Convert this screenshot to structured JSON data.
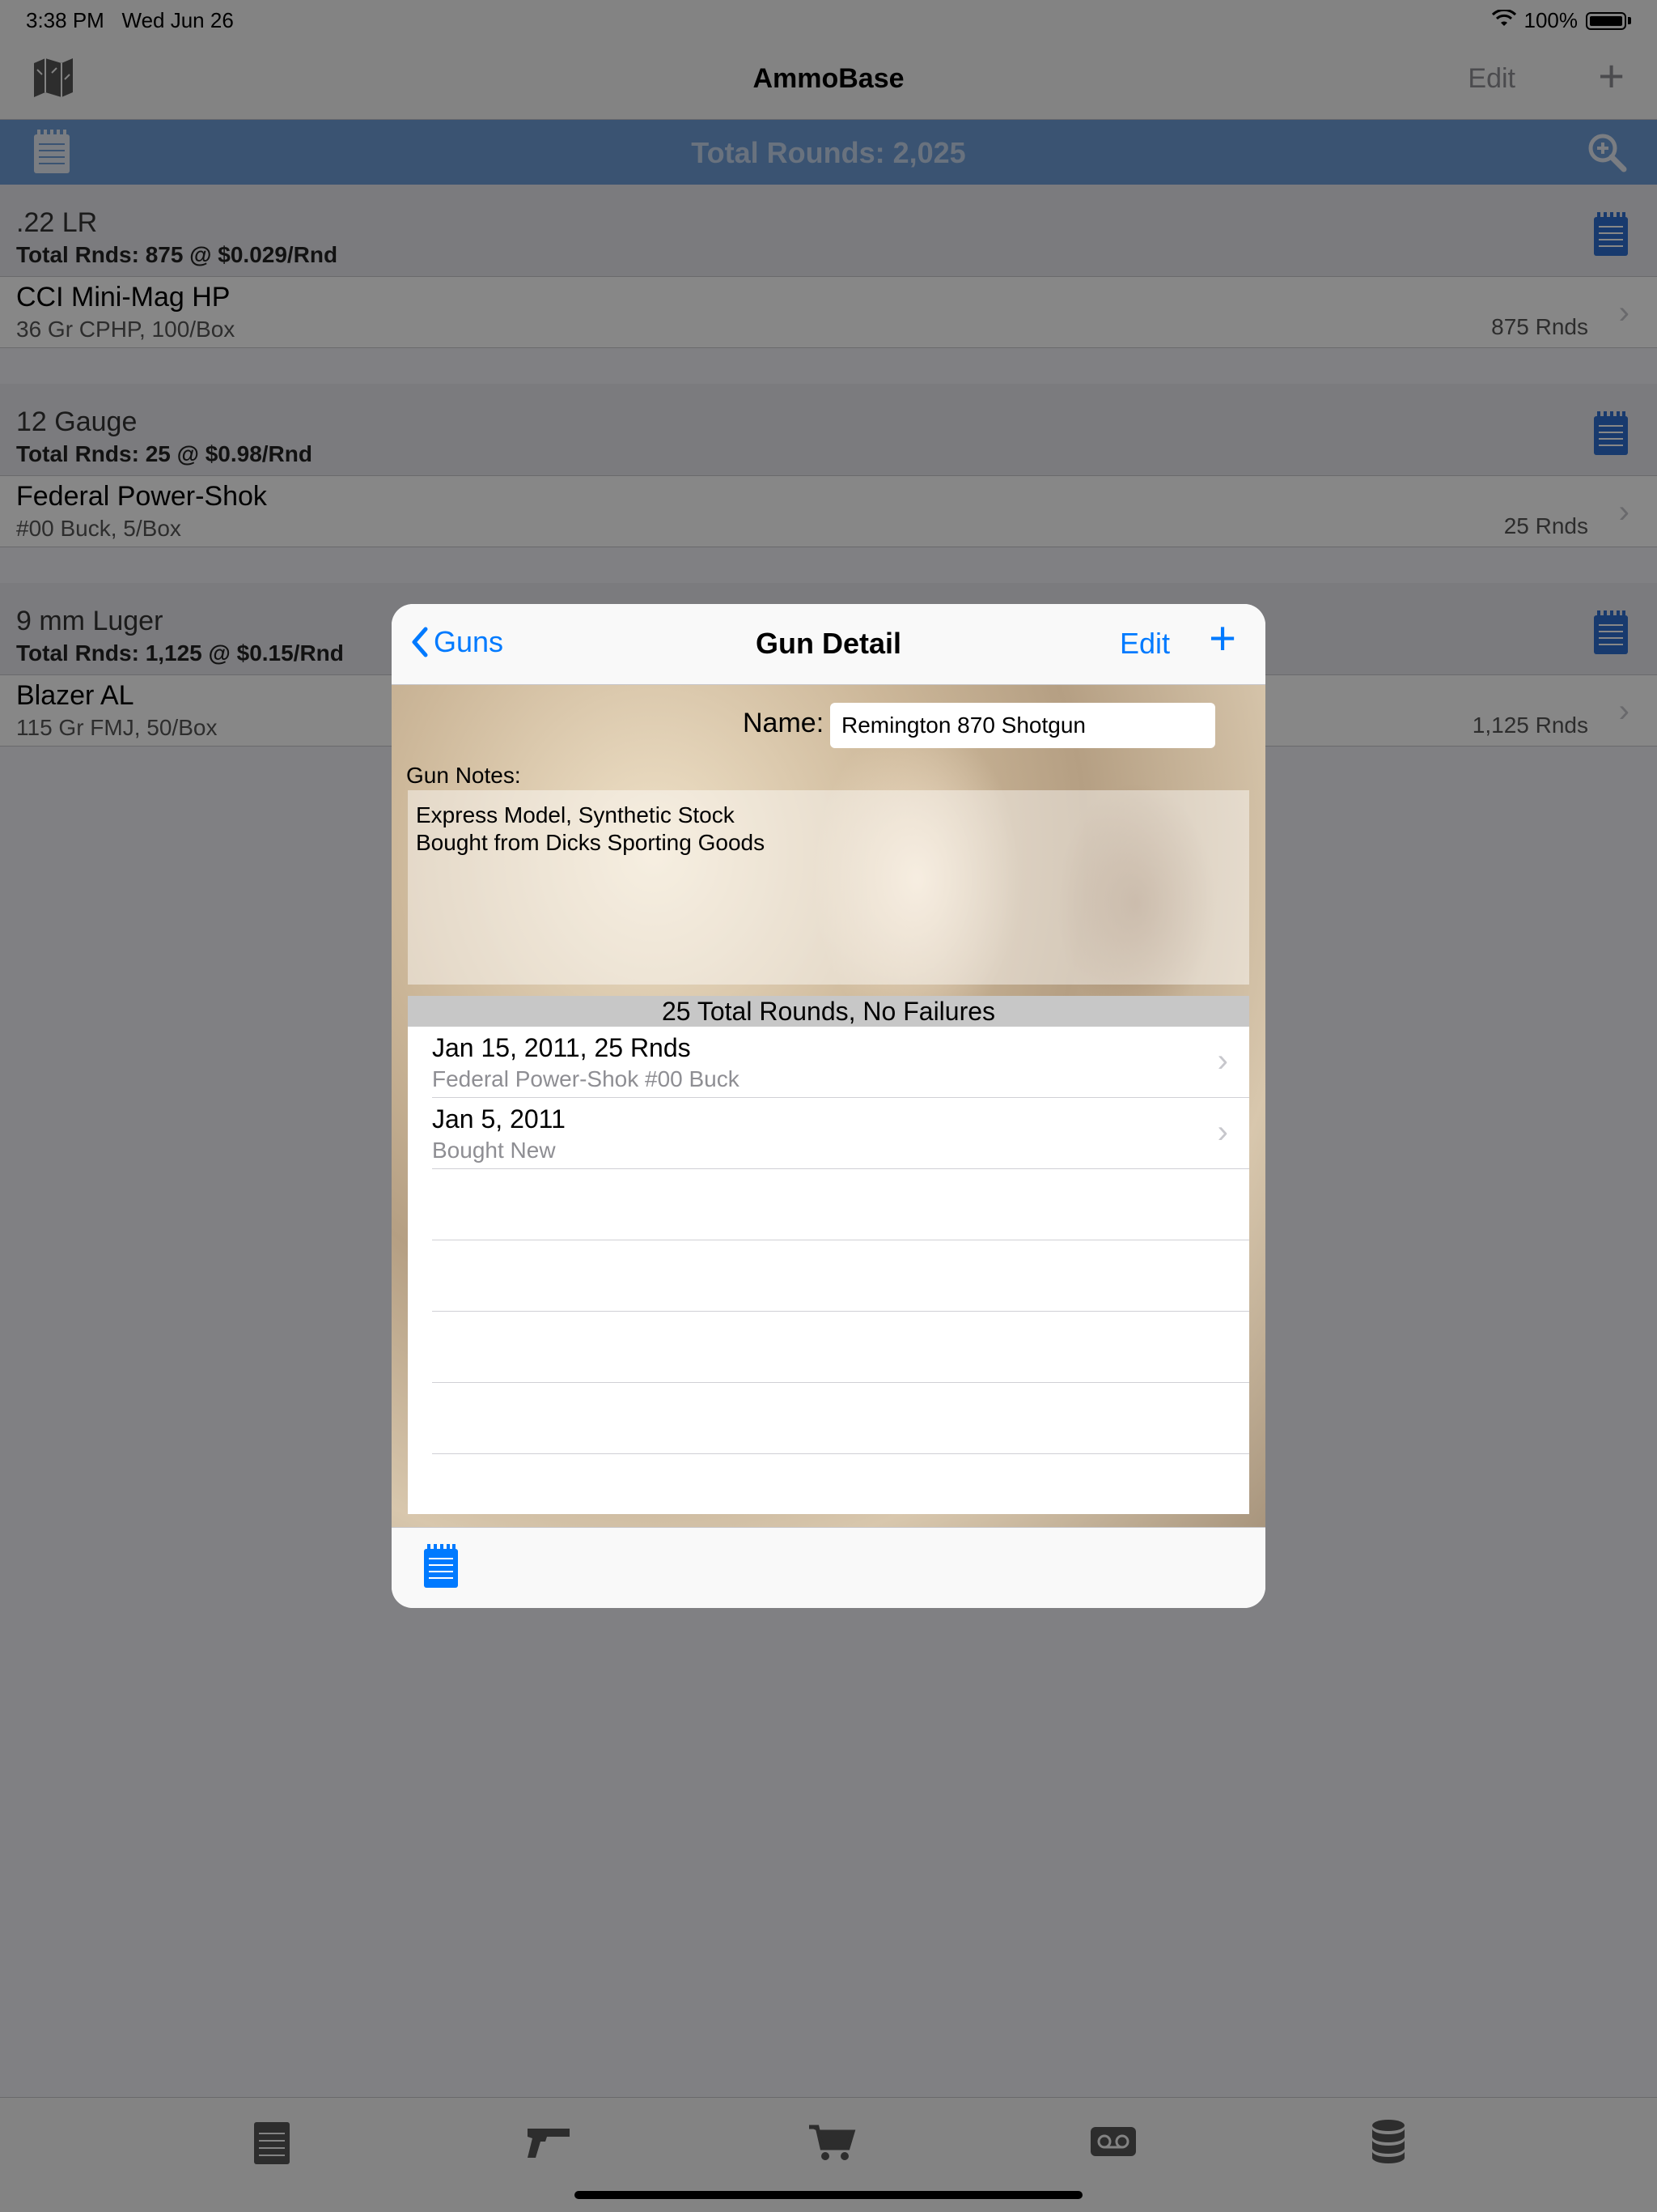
{
  "status_bar": {
    "time": "3:38 PM",
    "date": "Wed Jun 26",
    "battery": "100%"
  },
  "navbar": {
    "title": "AmmoBase",
    "edit_label": "Edit",
    "add_label": "+"
  },
  "summary": {
    "text": "Total Rounds: 2,025"
  },
  "sections": [
    {
      "caliber": ".22 LR",
      "total": "Total Rnds: 875 @ $0.029/Rnd",
      "ammo": {
        "name": "CCI Mini-Mag HP",
        "detail": "36 Gr CPHP, 100/Box",
        "rounds": "875 Rnds"
      }
    },
    {
      "caliber": "12 Gauge",
      "total": "Total Rnds: 25 @ $0.98/Rnd",
      "ammo": {
        "name": "Federal Power-Shok",
        "detail": "#00 Buck, 5/Box",
        "rounds": "25 Rnds"
      }
    },
    {
      "caliber": "9 mm Luger",
      "total": "Total Rnds: 1,125 @ $0.15/Rnd",
      "ammo": {
        "name": "Blazer AL",
        "detail": "115 Gr FMJ, 50/Box",
        "rounds": "1,125 Rnds"
      }
    }
  ],
  "modal": {
    "back_label": "Guns",
    "title": "Gun Detail",
    "edit_label": "Edit",
    "add_label": "+",
    "name_label": "Name:",
    "name_value": "Remington 870 Shotgun",
    "notes_label": "Gun Notes:",
    "notes_text": "Express Model, Synthetic Stock\nBought from Dicks Sporting Goods",
    "events_header": "25 Total Rounds, No Failures",
    "events": [
      {
        "title": "Jan 15, 2011, 25 Rnds",
        "subtitle": "Federal Power-Shok #00 Buck"
      },
      {
        "title": "Jan 5, 2011",
        "subtitle": "Bought New"
      }
    ]
  },
  "colors": {
    "accent": "#007aff",
    "summary_bar": "#6e9dd8",
    "notes_icon": "#2f6fd0"
  },
  "tabs": [
    "notes-tab-icon",
    "gun-tab-icon",
    "cart-tab-icon",
    "voicemail-tab-icon",
    "database-tab-icon"
  ]
}
